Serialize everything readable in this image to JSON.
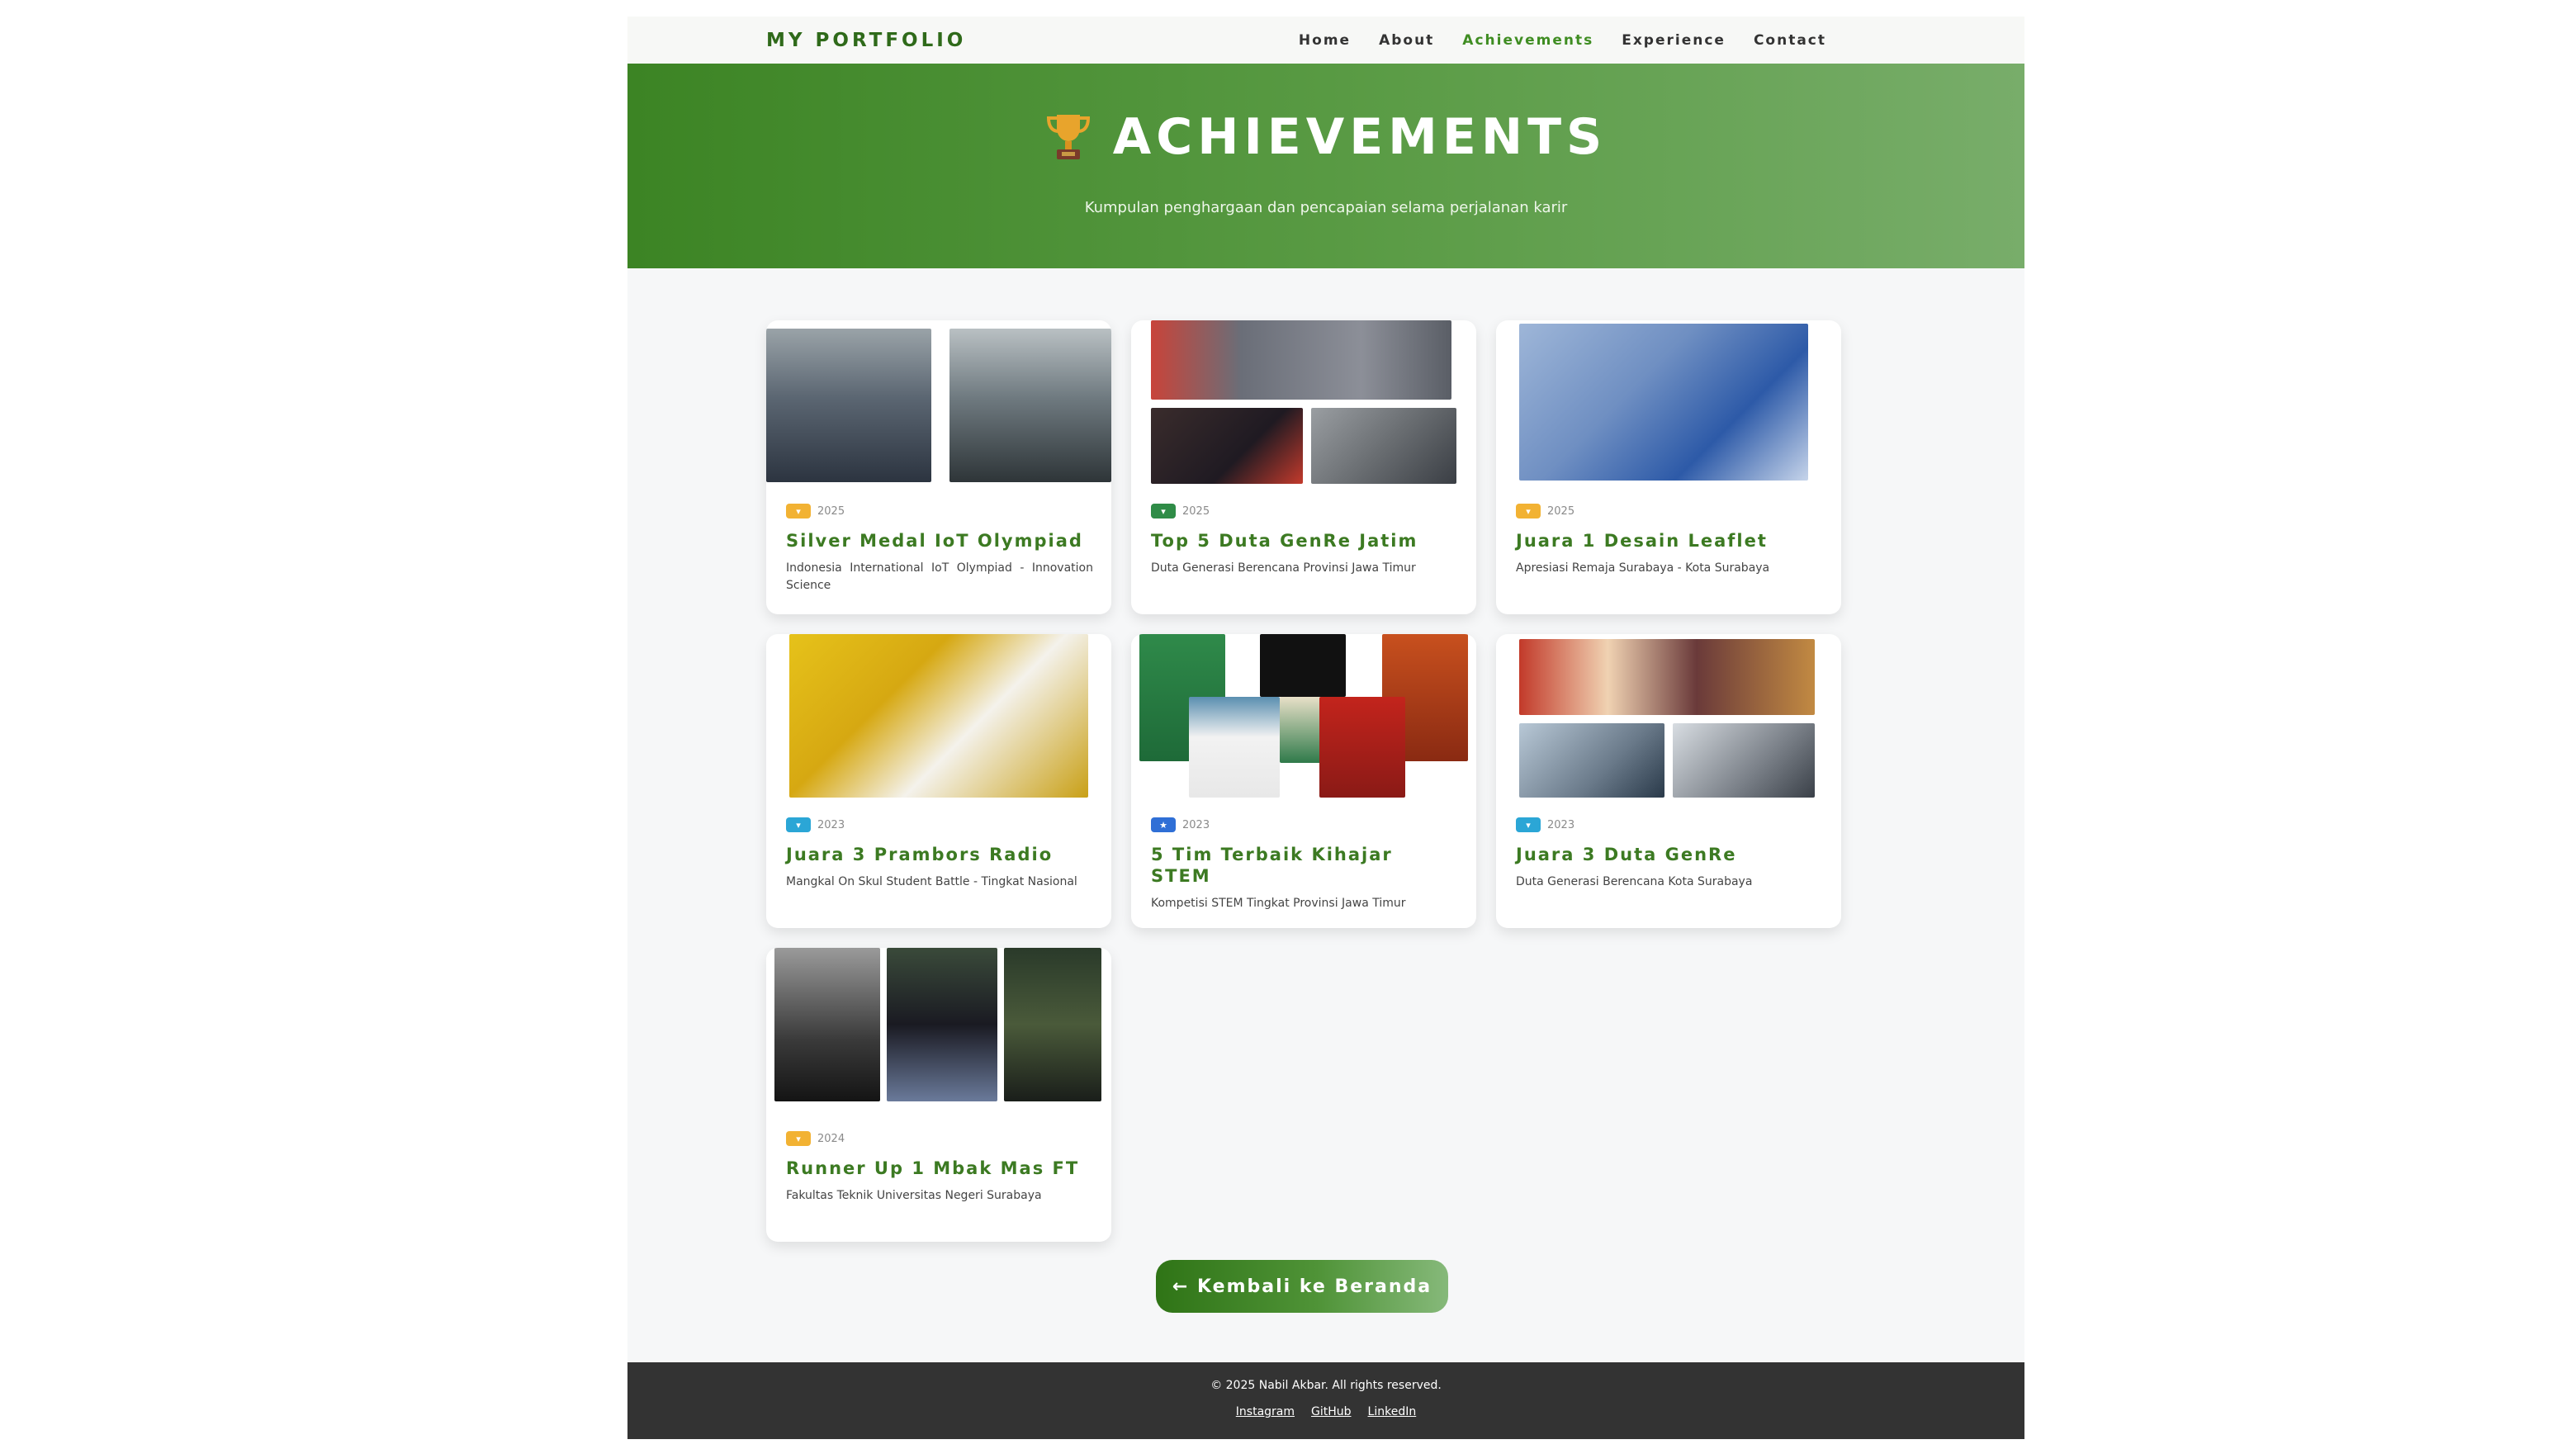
{
  "nav": {
    "brand": "MY PORTFOLIO",
    "links": [
      "Home",
      "About",
      "Achievements",
      "Experience",
      "Contact"
    ],
    "active": "Achievements"
  },
  "hero": {
    "icon": "trophy-icon",
    "title": "ACHIEVEMENTS",
    "subtitle": "Kumpulan penghargaan dan pencapaian selama perjalanan karir"
  },
  "achievements": [
    {
      "badge_color": "#f2b233",
      "badge_icon": "medal-icon",
      "year": "2025",
      "title": "Silver Medal IoT Olympiad",
      "description": "Indonesia International IoT Olympiad - Innovation Science"
    },
    {
      "badge_color": "#2f8c47",
      "badge_icon": "medal-icon",
      "year": "2025",
      "title": "Top 5 Duta GenRe Jatim",
      "description": "Duta Generasi Berencana Provinsi Jawa Timur"
    },
    {
      "badge_color": "#f2b233",
      "badge_icon": "medal-icon",
      "year": "2025",
      "title": "Juara 1 Desain Leaflet",
      "description": "Apresiasi Remaja Surabaya - Kota Surabaya"
    },
    {
      "badge_color": "#2ba6d6",
      "badge_icon": "medal-icon",
      "year": "2023",
      "title": "Juara 3 Prambors Radio",
      "description": "Mangkal On Skul Student Battle - Tingkat Nasional"
    },
    {
      "badge_color": "#2f6fd6",
      "badge_icon": "star-icon",
      "year": "2023",
      "title": "5 Tim Terbaik Kihajar STEM",
      "description": "Kompetisi STEM Tingkat Provinsi Jawa Timur"
    },
    {
      "badge_color": "#2ba6d6",
      "badge_icon": "medal-icon",
      "year": "2023",
      "title": "Juara 3 Duta GenRe",
      "description": "Duta Generasi Berencana Kota Surabaya"
    },
    {
      "badge_color": "#f2b233",
      "badge_icon": "medal-icon",
      "year": "2024",
      "title": "Runner Up 1 Mbak Mas FT",
      "description": "Fakultas Teknik Universitas Negeri Surabaya"
    }
  ],
  "back_button": "← Kembali ke Beranda",
  "footer": {
    "copyright": "© 2025 Nabil Akbar. All rights reserved.",
    "links": [
      "Instagram",
      "GitHub",
      "LinkedIn"
    ]
  }
}
